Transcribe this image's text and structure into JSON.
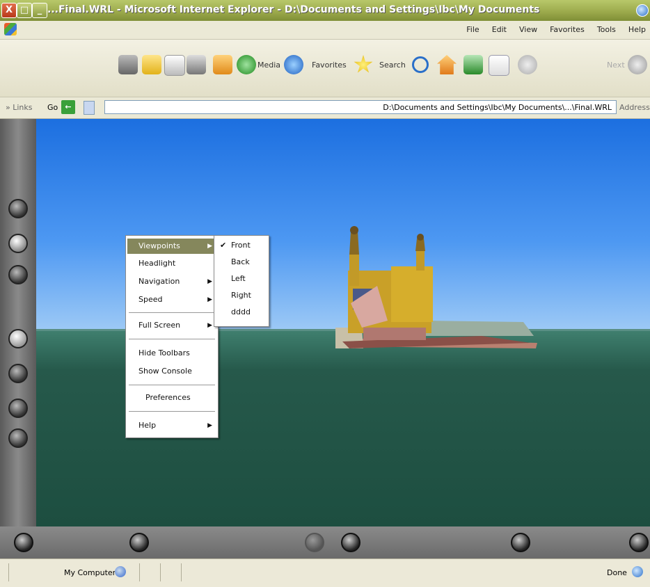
{
  "window": {
    "title": "...Final.WRL - Microsoft Internet Explorer - D:\\Documents and Settings\\Ibc\\My Documents",
    "close_glyph": "X",
    "max_glyph": "□",
    "min_glyph": "_"
  },
  "menu": {
    "items": [
      "Help",
      "Tools",
      "Favorites",
      "View",
      "Edit",
      "File"
    ]
  },
  "toolbar": {
    "media_label": "Media",
    "favorites_label": "Favorites",
    "search_label": "Search",
    "next_label": "Next"
  },
  "address": {
    "links_label": "» Links",
    "go_label": "Go",
    "value": "D:\\Documents and Settings\\Ibc\\My Documents\\...\\Final.WRL",
    "address_label": "Address"
  },
  "context_menu": {
    "items": [
      {
        "label": "Viewpoints",
        "submenu": true,
        "highlighted": true
      },
      {
        "label": "Headlight",
        "submenu": false
      },
      {
        "label": "Navigation",
        "submenu": true
      },
      {
        "label": "Speed",
        "submenu": true
      },
      {
        "label": "Full Screen",
        "submenu": true
      },
      {
        "label": "Hide Toolbars",
        "submenu": false
      },
      {
        "label": "Show Console",
        "submenu": false
      },
      {
        "label": "Preferences",
        "submenu": false
      },
      {
        "label": "Help",
        "submenu": true
      }
    ],
    "arrow": "▶"
  },
  "viewpoints_submenu": {
    "items": [
      {
        "label": "Front",
        "checked": true
      },
      {
        "label": "Back",
        "checked": false
      },
      {
        "label": "Left",
        "checked": false
      },
      {
        "label": "Right",
        "checked": false
      },
      {
        "label": "dddd",
        "checked": false
      }
    ],
    "check_glyph": "✔"
  },
  "status": {
    "zone": "My Computer",
    "done": "Done"
  }
}
